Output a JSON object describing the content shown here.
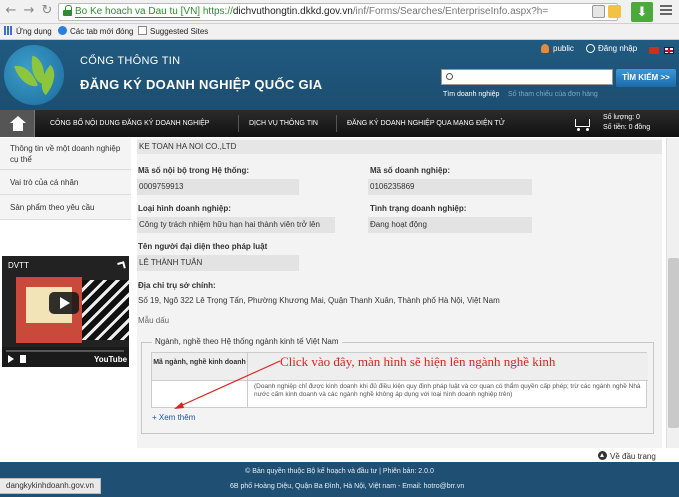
{
  "browser": {
    "back": "←",
    "forward": "→",
    "reload": "↻",
    "cert_label": "Bo Ke hoach va Dau tu [VN]",
    "url_https": "https://",
    "url_host": "dichvuthongtin.dkkd.gov.vn",
    "url_path": "/inf/Forms/Searches/EnterpriseInfo.aspx?h=",
    "download_icon": "⬇",
    "bookmarks": [
      "Ứng dụng",
      "Các tab mới đóng",
      "Suggested Sites"
    ]
  },
  "header": {
    "subtitle": "CỔNG THÔNG TIN",
    "title": "ĐĂNG KÝ DOANH NGHIỆP QUỐC GIA",
    "user_label": "public",
    "login_label": "Đăng nhập",
    "search_button": "TÌM KIẾM >>",
    "search_tabs": [
      "Tìm doanh nghiệp",
      "Số tham chiếu của đơn hàng"
    ]
  },
  "nav": {
    "items": [
      "CÔNG BỐ NỘI DUNG ĐĂNG KÝ DOANH NGHIỆP",
      "DỊCH VỤ THÔNG TIN",
      "ĐĂNG KÝ DOANH NGHIỆP QUA MẠNG ĐIỆN TỬ"
    ],
    "cart_quantity": "Số lượng: 0",
    "cart_amount": "Số tiền: 0 đồng"
  },
  "sidebar": {
    "items": [
      "Thông tin về một doanh nghiệp cụ thể",
      "Vai trò của cá nhân",
      "Sản phẩm theo yêu cầu"
    ],
    "video_title": "DVTT",
    "video_brand": "YouTube"
  },
  "company": {
    "name": "KE TOAN HA NOI CO.,LTD",
    "internal_id_label": "Mã số nội bộ trong Hệ thống:",
    "internal_id": "0009759913",
    "tax_id_label": "Mã số doanh nghiệp:",
    "tax_id": "0106235869",
    "type_label": "Loại hình doanh nghiệp:",
    "type": "Công ty trách nhiệm hữu hạn hai thành viên trở lên",
    "status_label": "Tình trạng doanh nghiệp:",
    "status": "Đang hoạt động",
    "rep_label": "Tên người đại diện theo pháp luật",
    "rep": "LÊ THÀNH TUÂN",
    "address_label": "Địa chỉ trụ sở chính:",
    "address": "Số 19, Ngõ 322 Lê Trọng Tấn, Phường Khương Mai, Quận Thanh Xuân, Thành phố Hà Nội, Việt Nam",
    "seal_label": "Mẫu dấu"
  },
  "industry": {
    "legend": "Ngành, nghề theo Hệ thống ngành kinh tế Việt Nam",
    "col_header": "Mã ngành, nghề kinh doanh",
    "note": "(Doanh nghiệp chỉ được kinh doanh khi đủ điều kiện quy định pháp luật và cơ quan có thẩm quyền cấp phép; trừ các ngành nghề Nhà nước cấm kinh doanh và các ngành nghề không áp dụng với loại hình doanh nghiệp trên)",
    "see_more": "+ Xem thêm",
    "annotation": "Click vào đây, màn hình sẽ hiện lên ngành nghề kinh"
  },
  "footer": {
    "back_to_top": "Về đầu trang",
    "line1": "© Bản quyền thuộc Bộ kế hoạch và đầu tư | Phiên bản: 2.0.0",
    "line2": "6B phố Hoàng Diệu, Quận Ba Đình, Hà Nội, Việt nam - Email: hotro@brr.vn",
    "status_url": "dangkykinhdoanh.gov.vn"
  },
  "colors": {
    "header_bg": "#215a80",
    "accent_green": "#8cc63f",
    "annotation_red": "#e02020",
    "link_blue": "#1a55a0"
  }
}
